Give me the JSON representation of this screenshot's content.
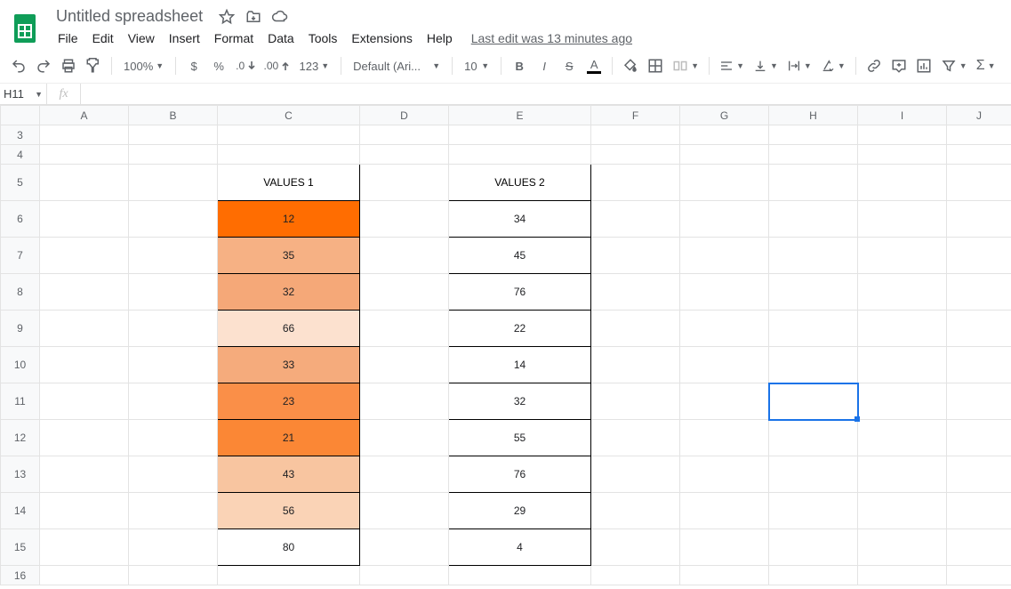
{
  "doc": {
    "title": "Untitled spreadsheet",
    "last_edit": "Last edit was 13 minutes ago"
  },
  "menus": {
    "file": "File",
    "edit": "Edit",
    "view": "View",
    "insert": "Insert",
    "format": "Format",
    "data": "Data",
    "tools": "Tools",
    "extensions": "Extensions",
    "help": "Help"
  },
  "toolbar": {
    "zoom": "100%",
    "currency": "$",
    "percent": "%",
    "dec_dec": ".0",
    "dec_inc": ".00",
    "num_fmt": "123",
    "font": "Default (Ari...",
    "size": "10",
    "bold": "B",
    "italic": "I",
    "strike": "S",
    "textcolor": "A"
  },
  "namebox": "H11",
  "fx_label": "fx",
  "columns": [
    "A",
    "B",
    "C",
    "D",
    "E",
    "F",
    "G",
    "H",
    "I",
    "J"
  ],
  "rows": [
    3,
    4,
    5,
    6,
    7,
    8,
    9,
    10,
    11,
    12,
    13,
    14,
    15,
    16
  ],
  "active": {
    "col": "H",
    "row": 11
  },
  "table": {
    "C": {
      "header": "VALUES 1",
      "cells": [
        {
          "val": "12",
          "bg": "#ff6d01"
        },
        {
          "val": "35",
          "bg": "#f6b184"
        },
        {
          "val": "32",
          "bg": "#f5a878"
        },
        {
          "val": "66",
          "bg": "#fce1cf"
        },
        {
          "val": "33",
          "bg": "#f5ab7c"
        },
        {
          "val": "23",
          "bg": "#fa8f48"
        },
        {
          "val": "21",
          "bg": "#fb8735"
        },
        {
          "val": "43",
          "bg": "#f8c5a0"
        },
        {
          "val": "56",
          "bg": "#fad3b6"
        },
        {
          "val": "80",
          "bg": "#ffffff"
        }
      ]
    },
    "E": {
      "header": "VALUES 2",
      "cells": [
        {
          "val": "34",
          "bg": "#ffffff"
        },
        {
          "val": "45",
          "bg": "#ffffff"
        },
        {
          "val": "76",
          "bg": "#ffffff"
        },
        {
          "val": "22",
          "bg": "#ffffff"
        },
        {
          "val": "14",
          "bg": "#ffffff"
        },
        {
          "val": "32",
          "bg": "#ffffff"
        },
        {
          "val": "55",
          "bg": "#ffffff"
        },
        {
          "val": "76",
          "bg": "#ffffff"
        },
        {
          "val": "29",
          "bg": "#ffffff"
        },
        {
          "val": "4",
          "bg": "#ffffff"
        }
      ]
    }
  }
}
